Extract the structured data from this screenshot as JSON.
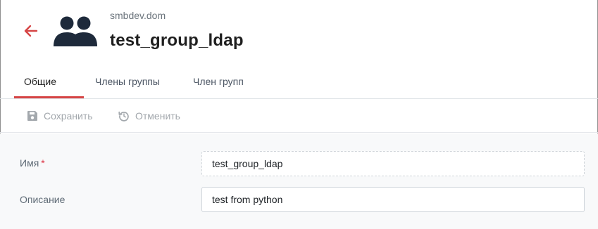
{
  "header": {
    "domain": "smbdev.dom",
    "title": "test_group_ldap",
    "accent_color": "#d64545"
  },
  "tabs": [
    {
      "label": "Общие",
      "active": true
    },
    {
      "label": "Члены группы",
      "active": false
    },
    {
      "label": "Член групп",
      "active": false
    }
  ],
  "toolbar": {
    "save_label": "Сохранить",
    "cancel_label": "Отменить"
  },
  "form": {
    "name_label": "Имя",
    "required_mark": "*",
    "name_value": "test_group_ldap",
    "description_label": "Описание",
    "description_value": "test from python"
  },
  "icons": [
    "back-arrow-icon",
    "group-icon",
    "save-icon",
    "undo-icon"
  ]
}
